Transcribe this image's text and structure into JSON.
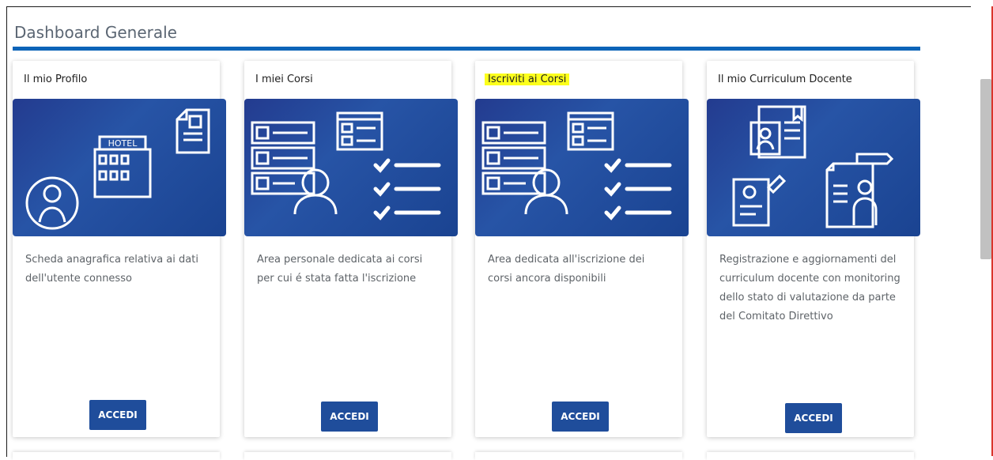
{
  "page": {
    "title": "Dashboard Generale",
    "accent": "#0d64b8"
  },
  "cards": [
    {
      "title": "Il mio Profilo",
      "description": "Scheda anagrafica relativa ai dati dell'utente connesso",
      "button": "ACCEDI",
      "image_icons": [
        "hotel-icon",
        "user-avatar-icon",
        "id-document-icon"
      ]
    },
    {
      "title": "I miei Corsi",
      "description": "Area personale dedicata ai corsi per cui é stata fatta l'iscrizione",
      "button": "ACCEDI",
      "image_icons": [
        "checklist-icon",
        "person-icon",
        "test-window-icon"
      ]
    },
    {
      "title": "Iscriviti ai Corsi",
      "description": "Area dedicata all'iscrizione dei corsi ancora disponibili",
      "button": "ACCEDI",
      "highlighted": true,
      "image_icons": [
        "checklist-icon",
        "person-icon",
        "test-window-icon"
      ]
    },
    {
      "title": "Il mio Curriculum Docente",
      "description": "Registrazione e aggiornamenti del curriculum docente con monitoring dello stato di valutazione da parte del Comitato Direttivo",
      "button": "ACCEDI",
      "image_icons": [
        "cv-document-icon",
        "profile-sheet-icon",
        "report-person-icon"
      ]
    }
  ],
  "hotel_sign": "HOTEL"
}
